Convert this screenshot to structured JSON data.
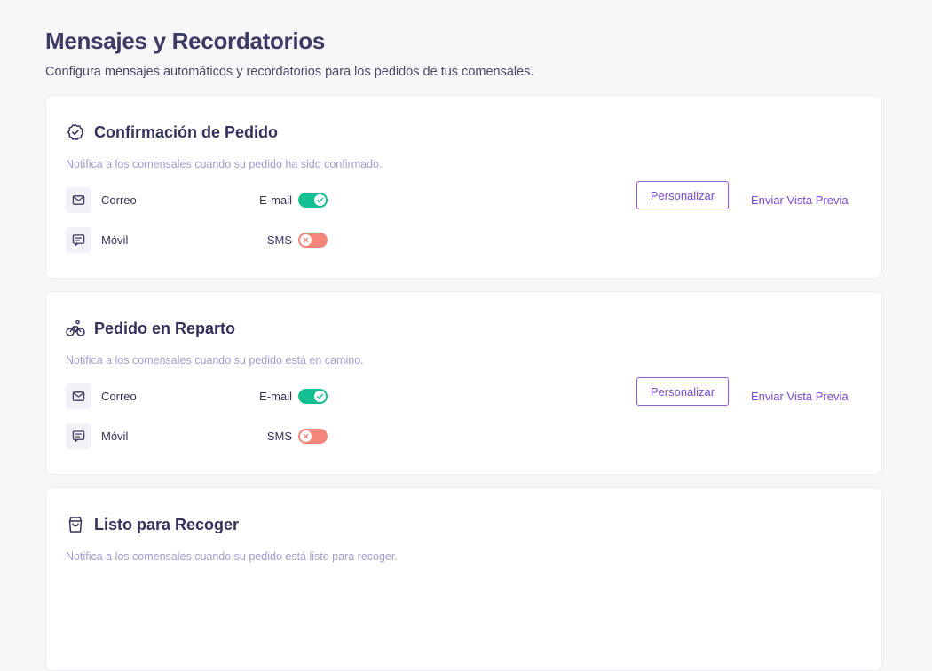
{
  "header": {
    "title": "Mensajes y Recordatorios",
    "subtitle": "Configura mensajes automáticos y recordatorios para los pedidos de tus comensales."
  },
  "cards": [
    {
      "icon": "check-badge-icon",
      "title": "Confirmación de Pedido",
      "description": "Notifica a los comensales cuando su pedido ha sido confirmado.",
      "rows": [
        {
          "icon": "mail-icon",
          "label": "Correo",
          "type": "E-mail",
          "enabled": true
        },
        {
          "icon": "message-icon",
          "label": "Móvil",
          "type": "SMS",
          "enabled": false
        }
      ],
      "customize_label": "Personalizar",
      "preview_label": "Enviar Vista Previa"
    },
    {
      "icon": "bike-icon",
      "title": "Pedido en Reparto",
      "description": "Notifica a los comensales cuando su pedido está en camino.",
      "rows": [
        {
          "icon": "mail-icon",
          "label": "Correo",
          "type": "E-mail",
          "enabled": true
        },
        {
          "icon": "message-icon",
          "label": "Móvil",
          "type": "SMS",
          "enabled": false
        }
      ],
      "customize_label": "Personalizar",
      "preview_label": "Enviar Vista Previa"
    },
    {
      "icon": "shopping-bag-icon",
      "title": "Listo para Recoger",
      "description": "Notifica a los comensales cuando su pedido está listo para recoger."
    }
  ],
  "colors": {
    "accent": "#7a48d0",
    "toggle_on": "#14bf92",
    "toggle_off": "#f4857a",
    "muted_text": "#a49ad0"
  }
}
